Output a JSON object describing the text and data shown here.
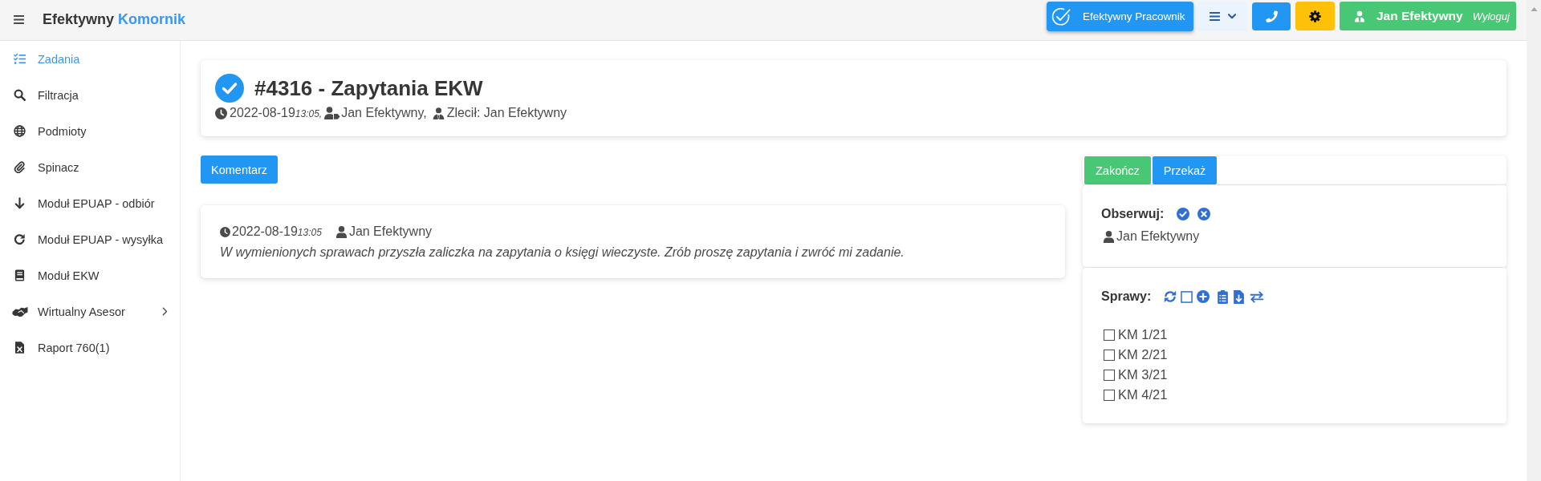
{
  "app_bar": {
    "title": "Efektywny",
    "title_accent": "Komornik",
    "buttons": [
      {
        "kind": "app",
        "label": "Efektywny Pracownik"
      },
      {
        "kind": "menu"
      },
      {
        "kind": "phone"
      },
      {
        "kind": "settings"
      },
      {
        "kind": "user",
        "label": "Jan Efektywny",
        "action": "Wyloguj"
      }
    ]
  },
  "sidebar": {
    "items": [
      {
        "kind": "tasks",
        "label": "Zadania",
        "selected": true,
        "submenu": false
      },
      {
        "kind": "search",
        "label": "Filtracja",
        "selected": false,
        "submenu": false
      },
      {
        "kind": "entities",
        "label": "Podmioty",
        "selected": false,
        "submenu": false
      },
      {
        "kind": "clip",
        "label": "Spinacz",
        "selected": false,
        "submenu": false
      },
      {
        "kind": "receive",
        "label": "Moduł EPUAP - odbiór",
        "selected": false,
        "submenu": false
      },
      {
        "kind": "send",
        "label": "Moduł EPUAP - wysyłka",
        "selected": false,
        "submenu": false
      },
      {
        "kind": "ekw",
        "label": "Moduł EKW",
        "selected": false,
        "submenu": false
      },
      {
        "kind": "assessor",
        "label": "Wirtualny Asesor",
        "selected": false,
        "submenu": true
      },
      {
        "kind": "report",
        "label": "Raport 760(1)",
        "selected": false,
        "submenu": false
      }
    ]
  },
  "task": {
    "title": "#4316 - Zapytania EKW",
    "date": "2022-08-19",
    "time": "13:05,",
    "assignee": "Jan Efektywny,",
    "ordered_by": "Zlecił: Jan Efektywny"
  },
  "comment_button": "Komentarz",
  "comments": [
    {
      "date": "2022-08-19",
      "time": "13:05",
      "author": "Jan Efektywny",
      "text": "W wymienionych sprawach przyszła zaliczka na zapytania o księgi wieczyste. Zrób proszę zapytania i zwróć mi zadanie."
    }
  ],
  "side_panel": {
    "tabs": [
      {
        "kind": "finish",
        "label": "Zakończ"
      },
      {
        "kind": "forward",
        "label": "Przekaż"
      }
    ],
    "observe": {
      "label": "Obserwuj:",
      "observers": [
        "Jan Efektywny"
      ]
    },
    "cases": {
      "label": "Sprawy:",
      "select_all": {
        "checked": false
      },
      "items": [
        {
          "label": "KM 1/21",
          "checked": false
        },
        {
          "label": "KM 2/21",
          "checked": false
        },
        {
          "label": "KM 3/21",
          "checked": false
        },
        {
          "label": "KM 4/21",
          "checked": false
        }
      ]
    }
  }
}
